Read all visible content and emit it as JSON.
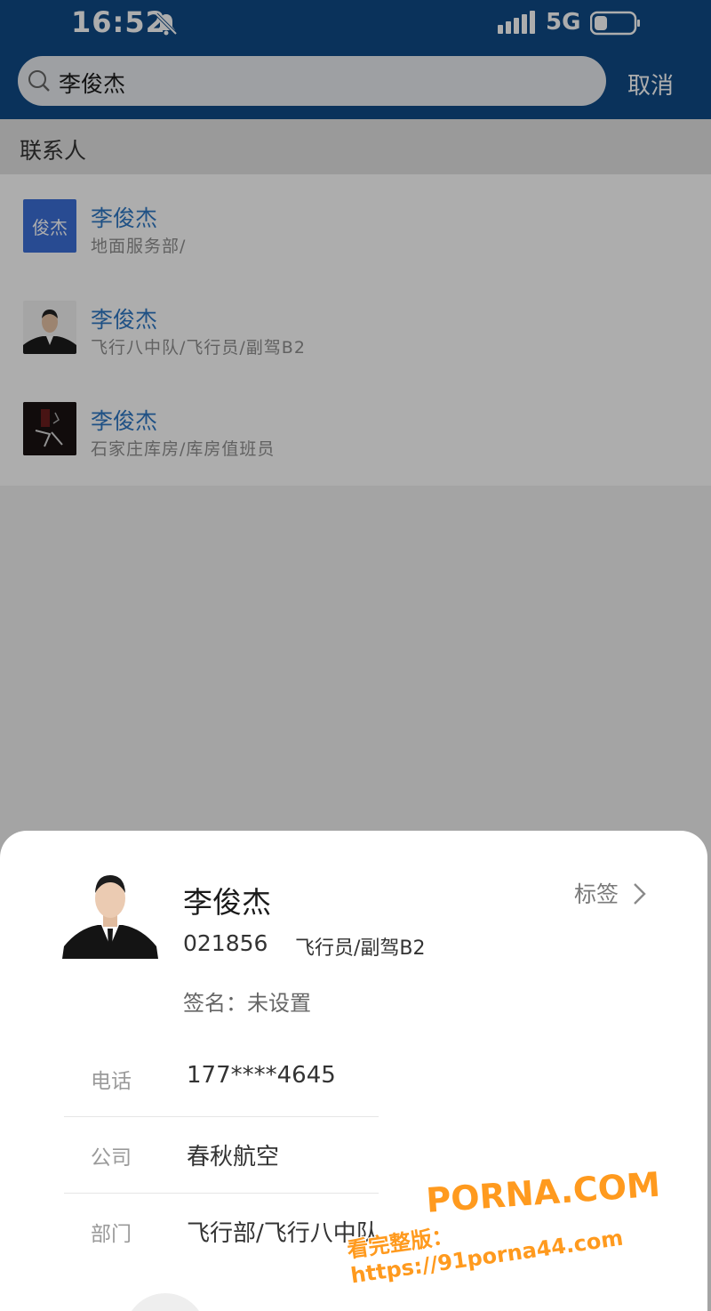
{
  "status_bar": {
    "time": "16:52",
    "network": "5G",
    "icons": [
      "bell-off-icon",
      "signal-icon",
      "battery-icon"
    ]
  },
  "search": {
    "query": "李俊杰",
    "cancel_label": "取消",
    "icon": "search-icon"
  },
  "results": {
    "section_title": "联系人",
    "items": [
      {
        "name": "李俊杰",
        "subtitle": "地面服务部/",
        "avatar_text": "俊杰"
      },
      {
        "name": "李俊杰",
        "subtitle": "飞行八中队/飞行员/副驾B2",
        "avatar_text": ""
      },
      {
        "name": "李俊杰",
        "subtitle": "石家庄库房/库房值班员",
        "avatar_text": ""
      }
    ]
  },
  "profile": {
    "name": "李俊杰",
    "tag_label": "标签",
    "employee_id": "021856",
    "role": "飞行员/副驾B2",
    "signature": "签名：未设置",
    "fields": [
      {
        "label": "电话",
        "value": "177****4645"
      },
      {
        "label": "公司",
        "value": "春秋航空"
      },
      {
        "label": "部门",
        "value": "飞行部/飞行八中队"
      }
    ]
  },
  "watermark": {
    "line1": "PORNA.COM",
    "line2": "看完整版：https://91porna44.com"
  },
  "colors": {
    "header": "#0f4a86",
    "link": "#2f78c4",
    "avatar_bg": "#3b6fd8",
    "watermark": "#ff9a1e"
  }
}
